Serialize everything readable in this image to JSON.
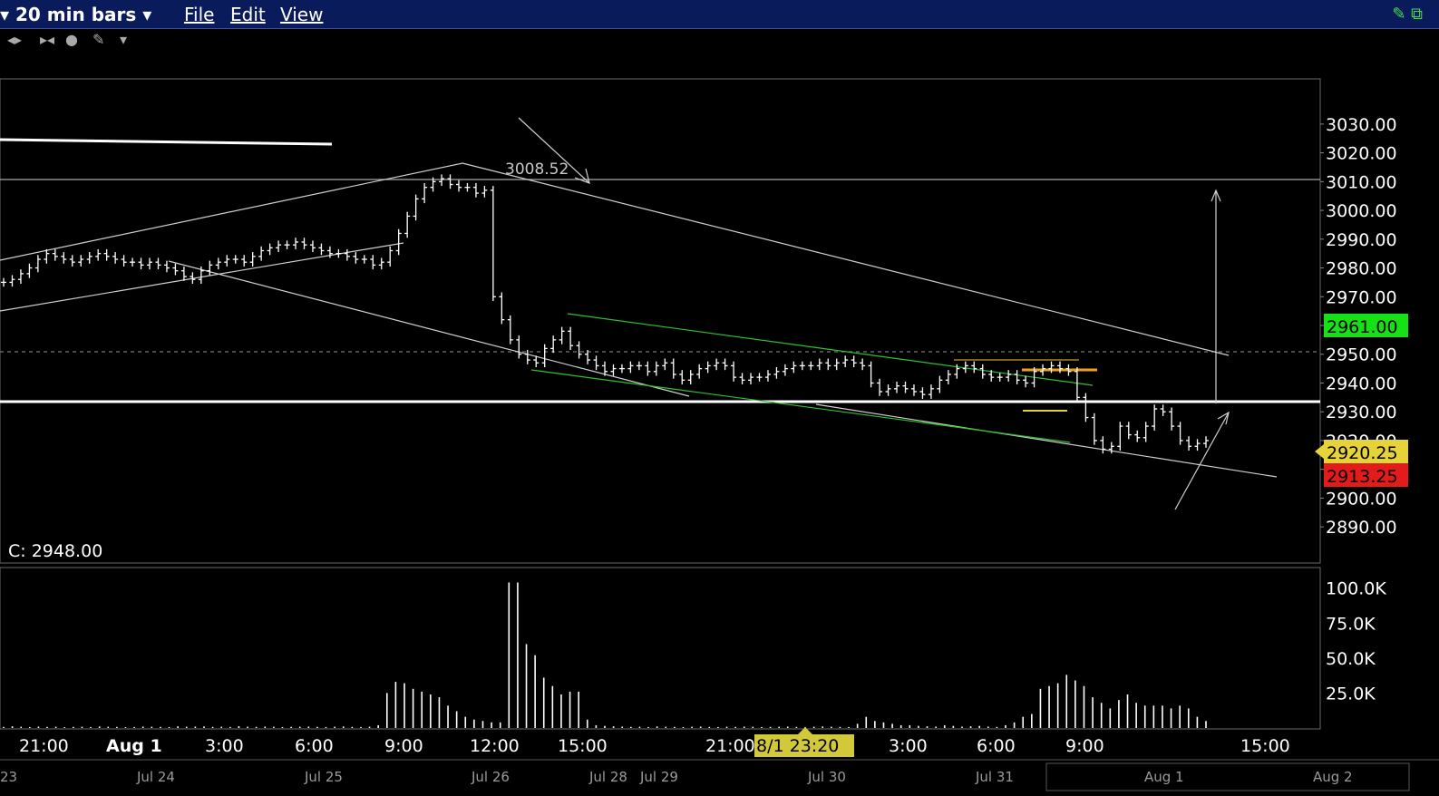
{
  "toolbar": {
    "period_label": "20 min bars",
    "menu": [
      "File",
      "Edit",
      "View"
    ]
  },
  "chart_data": [
    {
      "type": "line",
      "title": "",
      "price_axis": {
        "ticks": [
          "3030.00",
          "3020.00",
          "3010.00",
          "3000.00",
          "2990.00",
          "2980.00",
          "2970.00",
          "2960.00",
          "2950.00",
          "2940.00",
          "2930.00",
          "2920.00",
          "2910.00",
          "2900.00",
          "2890.00"
        ],
        "ylim": [
          2885,
          3035
        ]
      },
      "annotations": {
        "peak_label": "3008.52",
        "close_label": "C: 2948.00"
      },
      "price_badges": [
        {
          "text": "2961.00",
          "color": "#16e016",
          "text_color": "#000"
        },
        {
          "text": "2920.25",
          "color": "#e6d33a",
          "text_color": "#000"
        },
        {
          "text": "2913.25",
          "color": "#e21b1b",
          "text_color": "#000"
        }
      ],
      "series": [
        {
          "values": [
            2975,
            2976,
            2978,
            2980,
            2983,
            2985,
            2984,
            2983,
            2982,
            2983,
            2984,
            2985,
            2984,
            2983,
            2982,
            2982,
            2981,
            2982,
            2981,
            2980,
            2979,
            2977,
            2976,
            2979,
            2981,
            2982,
            2983,
            2983,
            2982,
            2984,
            2986,
            2987,
            2988,
            2988,
            2989,
            2988,
            2987,
            2986,
            2985,
            2985,
            2984,
            2983,
            2983,
            2981,
            2982,
            2986,
            2992,
            2998,
            3004,
            3008,
            3010,
            3011,
            3009,
            3008,
            3008,
            3006,
            3007,
            2970,
            2962,
            2955,
            2950,
            2948,
            2947,
            2952,
            2955,
            2958,
            2953,
            2950,
            2948,
            2946,
            2944,
            2945,
            2945,
            2946,
            2946,
            2944,
            2946,
            2947,
            2943,
            2941,
            2943,
            2945,
            2946,
            2947,
            2946,
            2942,
            2941,
            2942,
            2942,
            2943,
            2944,
            2945,
            2946,
            2946,
            2946,
            2947,
            2946,
            2947,
            2948,
            2947,
            2946,
            2940,
            2937,
            2938,
            2939,
            2938,
            2937,
            2936,
            2938,
            2941,
            2943,
            2945,
            2946,
            2945,
            2943,
            2942,
            2942,
            2943,
            2941,
            2940,
            2944,
            2945,
            2946,
            2945,
            2944,
            2935,
            2928,
            2920,
            2917,
            2918,
            2925,
            2922,
            2921,
            2925,
            2931,
            2930,
            2925,
            2920,
            2918,
            2919,
            2920
          ]
        }
      ]
    },
    {
      "type": "bar",
      "title": "",
      "volume_axis": {
        "ticks": [
          "100.0K",
          "75.0K",
          "50.0K",
          "25.0K"
        ],
        "ylim": [
          0,
          105000
        ]
      },
      "series": [
        {
          "values": [
            800,
            1200,
            900,
            700,
            1000,
            800,
            900,
            600,
            800,
            900,
            700,
            1100,
            900,
            800,
            600,
            700,
            1000,
            900,
            800,
            700,
            1200,
            900,
            1000,
            1100,
            800,
            900,
            700,
            1300,
            900,
            800,
            1000,
            900,
            700,
            800,
            900,
            1000,
            800,
            700,
            900,
            1100,
            800,
            700,
            900,
            2000,
            25000,
            33000,
            32000,
            28000,
            26000,
            24000,
            22000,
            16000,
            12000,
            8000,
            6000,
            5000,
            4000,
            4000,
            104000,
            104000,
            60000,
            52000,
            36000,
            30000,
            24000,
            26000,
            26000,
            6000,
            2000,
            1500,
            1200,
            1000,
            800,
            900,
            700,
            1100,
            900,
            800,
            700,
            900,
            1000,
            800,
            700,
            900,
            800,
            1000,
            900,
            700,
            800,
            900,
            1000,
            800,
            700,
            900,
            1100,
            900,
            800,
            700,
            3000,
            8000,
            5000,
            4000,
            3000,
            2000,
            2000,
            1500,
            1200,
            1000,
            2000,
            1500,
            1000,
            1200,
            1500,
            1000,
            800,
            2000,
            4000,
            8000,
            10000,
            28000,
            30000,
            32000,
            38000,
            34000,
            30000,
            22000,
            18000,
            14000,
            20000,
            24000,
            18000,
            16000,
            16000,
            16000,
            14000,
            16000,
            14000,
            8000,
            5000
          ]
        }
      ]
    }
  ],
  "time_axis": {
    "primary": [
      "21:00",
      "Aug 1",
      "3:00",
      "6:00",
      "9:00",
      "12:00",
      "15:00",
      "21:00",
      "3:00",
      "6:00",
      "9:00",
      "15:00"
    ],
    "cursor": "8/1 23:20",
    "secondary": [
      "23",
      "Jul 24",
      "Jul 25",
      "Jul 26",
      "Jul 28",
      "Jul 29",
      "Jul 30",
      "Jul 31",
      "Aug 1",
      "Aug 2"
    ]
  },
  "colors": {
    "titlebar": "#0a1b5c",
    "bar": "#ffffff",
    "trendline": "#cfcfcf",
    "channel": "#2ec22e",
    "orange_marker": "#f0a020",
    "yellow_marker": "#e0d040",
    "cursor_badge": "#d2c93a"
  }
}
